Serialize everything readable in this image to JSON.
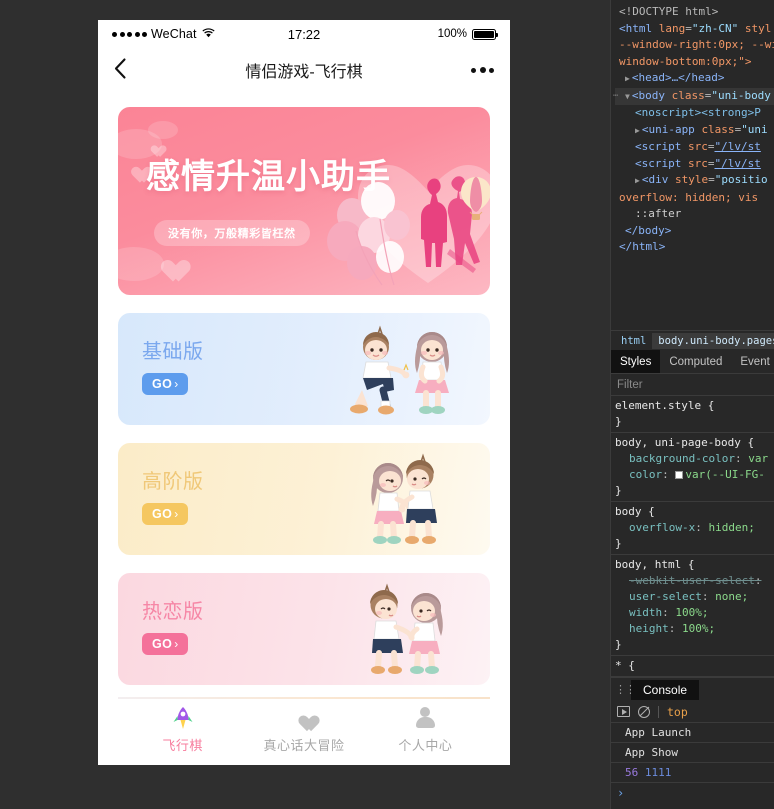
{
  "phone": {
    "statusbar": {
      "carrier": "WeChat",
      "time": "17:22",
      "battery_percent": "100%",
      "signal_dots": 5,
      "wifi_icon": "wifi-icon",
      "battery_icon": "battery-full-icon"
    },
    "navbar": {
      "back_icon": "chevron-left-icon",
      "title": "情侣游戏-飞行棋",
      "more_icon": "more-horizontal-icon"
    },
    "banner": {
      "title": "感情升温小助手",
      "subtitle": "没有你，万般精彩皆枉然",
      "bg_from": "#fb8496",
      "bg_to": "#fdb8c3"
    },
    "cards": [
      {
        "key": "basic",
        "title": "基础版",
        "go_label": "GO",
        "go_chevron": "›",
        "accent": "#5d9ced",
        "title_color": "#7ba8ee",
        "bg_from": "#d7e8fb",
        "bg_to": "#f2f7fe",
        "art": "couple-proposal-illustration"
      },
      {
        "key": "advanced",
        "title": "高阶版",
        "go_label": "GO",
        "go_chevron": "›",
        "accent": "#f5c760",
        "title_color": "#f0c878",
        "bg_from": "#fbecc8",
        "bg_to": "#fefaf0",
        "art": "couple-kiss-illustration"
      },
      {
        "key": "love",
        "title": "热恋版",
        "go_label": "GO",
        "go_chevron": "›",
        "accent": "#f4719a",
        "title_color": "#f687a6",
        "bg_from": "#fbd8e0",
        "bg_to": "#fdf2f5",
        "art": "couple-holding-hands-illustration"
      }
    ],
    "tabbar": [
      {
        "key": "flying-chess",
        "label": "飞行棋",
        "icon": "rocket-icon",
        "active": true,
        "color": "#f77e9e"
      },
      {
        "key": "truth-or-dare",
        "label": "真心话大冒险",
        "icon": "heart-icon",
        "active": false,
        "color": "#a8a8a8"
      },
      {
        "key": "profile",
        "label": "个人中心",
        "icon": "person-icon",
        "active": false,
        "color": "#a8a8a8"
      }
    ]
  },
  "devtools": {
    "dom": {
      "l1": "<!DOCTYPE html>",
      "l2_tag": "<html",
      "l2_attr": "lang",
      "l2_val": "\"zh-CN\"",
      "l2_attr2": "styl",
      "l3": "--window-right:0px; --wi",
      "l4": "window-bottom:0px;\">",
      "l5": "<head>…</head>",
      "l6_tag": "<body",
      "l6_attr": "class",
      "l6_val": "\"uni-body",
      "l7": "<noscript><strong>P",
      "l8_tag": "<uni-app",
      "l8_attr": "class",
      "l8_val": "\"uni",
      "l9_tag": "<script",
      "l9_attr": "src",
      "l9_val": "\"/lv/st",
      "l10_tag": "<script",
      "l10_attr": "src",
      "l10_val": "\"/lv/st",
      "l11_tag": "<div",
      "l11_attr": "style",
      "l11_val": "\"positio",
      "l12": "overflow: hidden; vis",
      "l13": "::after",
      "l14": "</body>",
      "l15": "</html>"
    },
    "breadcrumb": [
      {
        "label": "html",
        "active": false
      },
      {
        "label": "body.uni-body.pages-i",
        "active": true
      }
    ],
    "tabs": [
      {
        "label": "Styles",
        "active": true
      },
      {
        "label": "Computed",
        "active": false
      },
      {
        "label": "Event",
        "active": false
      }
    ],
    "filter_placeholder": "Filter",
    "styles": [
      {
        "selector": "element.style {",
        "close": "}",
        "props": []
      },
      {
        "selector": "body, uni-page-body {",
        "close": "}",
        "props": [
          {
            "name": "background-color",
            "value": "var",
            "swatch": false
          },
          {
            "name": "color",
            "value": "var(--UI-FG-",
            "swatch": true
          }
        ]
      },
      {
        "selector": "body {",
        "close": "}",
        "props": [
          {
            "name": "overflow-x",
            "value": "hidden;",
            "swatch": false
          }
        ]
      },
      {
        "selector": "body, html {",
        "close": "}",
        "props": [
          {
            "name": "-webkit-user-select",
            "value": "",
            "swatch": false,
            "struck": true
          },
          {
            "name": "user-select",
            "value": "none;",
            "swatch": false
          },
          {
            "name": "width",
            "value": "100%;",
            "swatch": false
          },
          {
            "name": "height",
            "value": "100%;",
            "swatch": false
          }
        ]
      },
      {
        "selector": "* {",
        "close": "",
        "props": []
      }
    ],
    "console": {
      "chip_label": "Console",
      "context": "top",
      "execute_icon": "execute-snippet-icon",
      "clear_icon": "clear-console-icon",
      "logs": [
        {
          "text": "App Launch",
          "type": "plain"
        },
        {
          "text": "App Show",
          "type": "plain"
        },
        {
          "text": "56 1111",
          "type": "numeric",
          "num1": "56",
          "num2": "1111"
        }
      ],
      "prompt": "›"
    }
  }
}
